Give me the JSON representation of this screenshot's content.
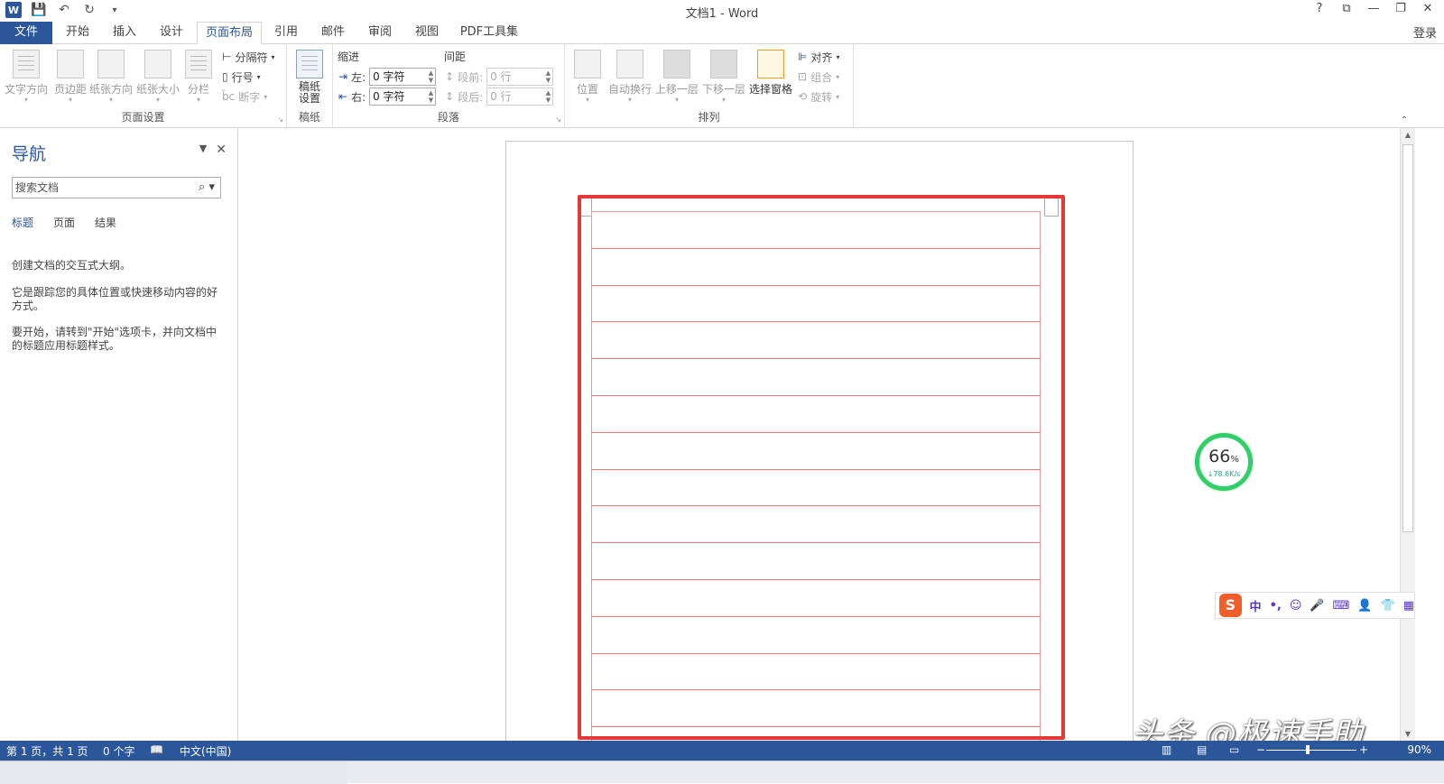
{
  "window": {
    "title": "文档1 - Word",
    "controls": [
      "?",
      "⧉",
      "—",
      "❐",
      "✕"
    ]
  },
  "tabs": {
    "file": "文件",
    "items": [
      "开始",
      "插入",
      "设计",
      "页面布局",
      "引用",
      "邮件",
      "审阅",
      "视图",
      "PDF工具集"
    ],
    "active": "页面布局",
    "login": "登录"
  },
  "ribbon": {
    "page_setup": {
      "label": "页面设置",
      "buttons": [
        "文字方向",
        "页边距",
        "纸张方向",
        "纸张大小",
        "分栏"
      ],
      "breaks": "分隔符",
      "line_numbers": "行号",
      "hyphenation": "断字"
    },
    "manuscript": {
      "label": "稿纸",
      "button_line1": "稿纸",
      "button_line2": "设置"
    },
    "paragraph": {
      "label": "段落",
      "indent_header": "缩进",
      "spacing_header": "间距",
      "left_label": "左:",
      "right_label": "右:",
      "left_value": "0 字符",
      "right_value": "0 字符",
      "before_label": "段前:",
      "after_label": "段后:",
      "before_value": "0 行",
      "after_value": "0 行"
    },
    "arrange": {
      "label": "排列",
      "buttons": [
        "位置",
        "自动换行",
        "上移一层",
        "下移一层",
        "选择窗格"
      ],
      "align": "对齐",
      "group": "组合",
      "rotate": "旋转"
    }
  },
  "navigation": {
    "title": "导航",
    "search_placeholder": "搜索文档",
    "tabs": [
      "标题",
      "页面",
      "结果"
    ],
    "active_tab": "标题",
    "para1": "创建文档的交互式大纲。",
    "para2": "它是跟踪您的具体位置或快速移动内容的好方式。",
    "para3": "要开始，请转到\"开始\"选项卡，并向文档中的标题应用标题样式。"
  },
  "overlay": {
    "gauge_percent": "66",
    "gauge_unit": "%",
    "gauge_speed": "↓78.6K/s",
    "ime_logo": "S",
    "ime_items": [
      "中",
      "•,",
      "☺",
      "🎤",
      "⌨",
      "👤",
      "👕",
      "▦"
    ],
    "watermark": "头条 @极速手助"
  },
  "statusbar": {
    "page": "第 1 页，共 1 页",
    "words": "0 个字",
    "language": "中文(中国)",
    "zoom": "90%"
  },
  "colors": {
    "accent": "#2b579a",
    "grid_line": "#e07878",
    "highlight": "#e53935",
    "gauge": "#2fcf6a"
  }
}
